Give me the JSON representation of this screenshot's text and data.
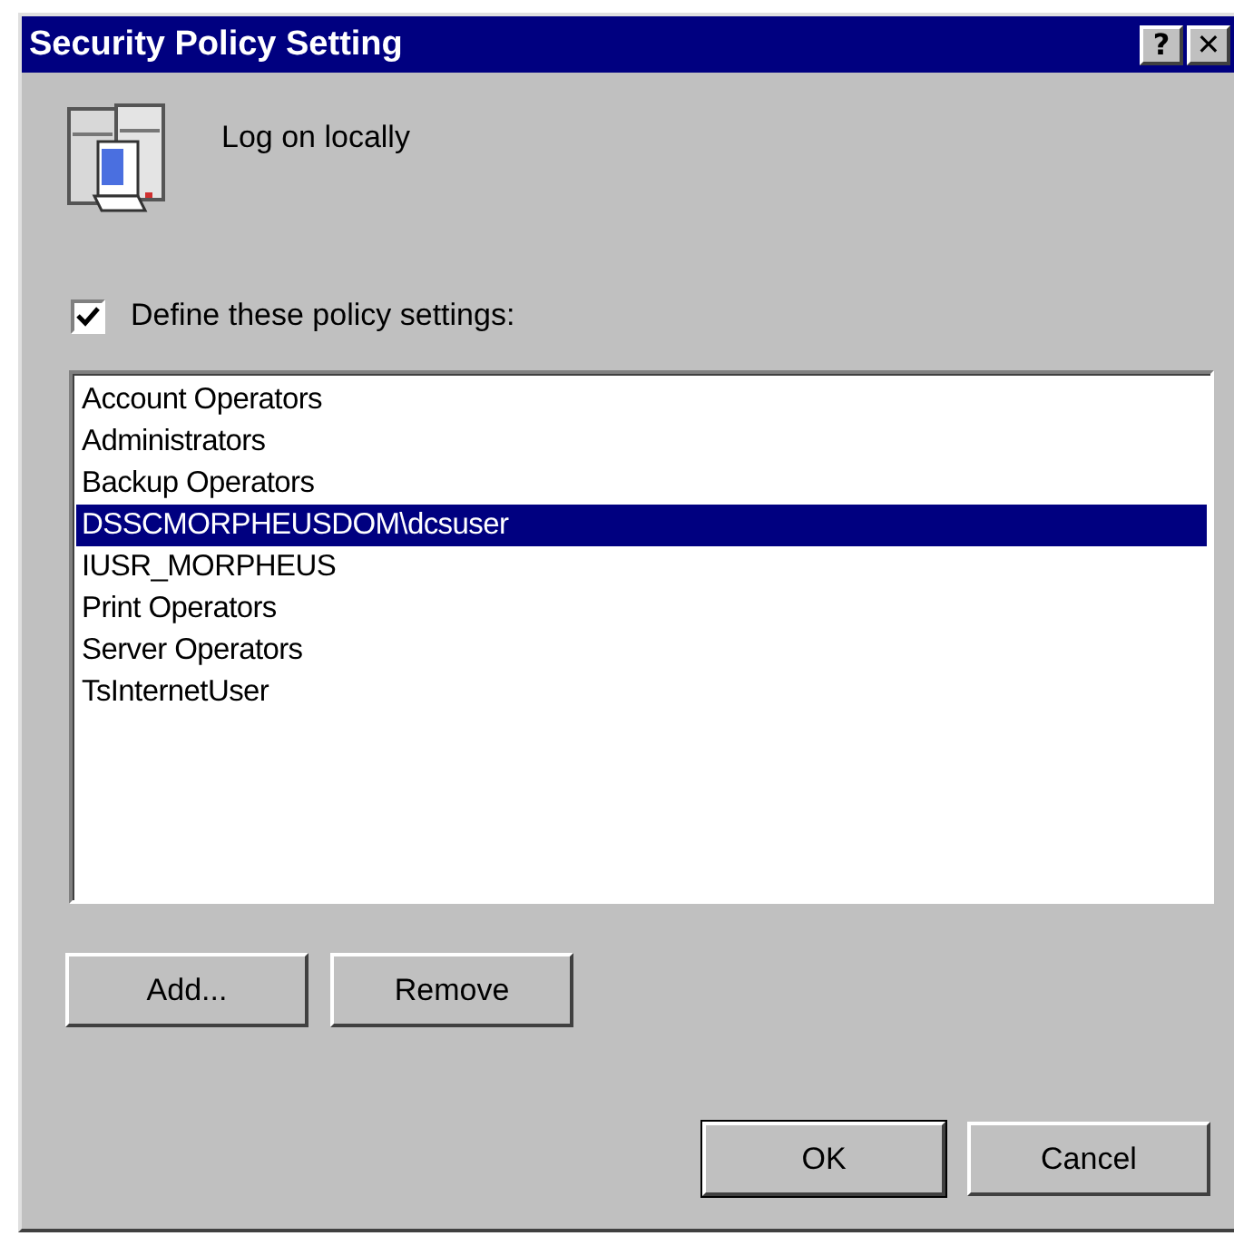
{
  "window": {
    "title": "Security Policy Setting",
    "title_buttons": [
      "?",
      "✕"
    ]
  },
  "policy": {
    "name": "Log on locally"
  },
  "define": {
    "label": "Define these policy settings:",
    "checked": true
  },
  "list": [
    {
      "label": "Account Operators",
      "selected": false
    },
    {
      "label": "Administrators",
      "selected": false
    },
    {
      "label": "Backup Operators",
      "selected": false
    },
    {
      "label": "DSSCMORPHEUSDOM\\dcsuser",
      "selected": true
    },
    {
      "label": "IUSR_MORPHEUS",
      "selected": false
    },
    {
      "label": "Print Operators",
      "selected": false
    },
    {
      "label": "Server Operators",
      "selected": false
    },
    {
      "label": "TsInternetUser",
      "selected": false
    }
  ],
  "list_buttons": [
    "Add...",
    "Remove"
  ],
  "buttons": [
    {
      "label": "OK",
      "default": true
    },
    {
      "label": "Cancel",
      "default": false
    }
  ]
}
